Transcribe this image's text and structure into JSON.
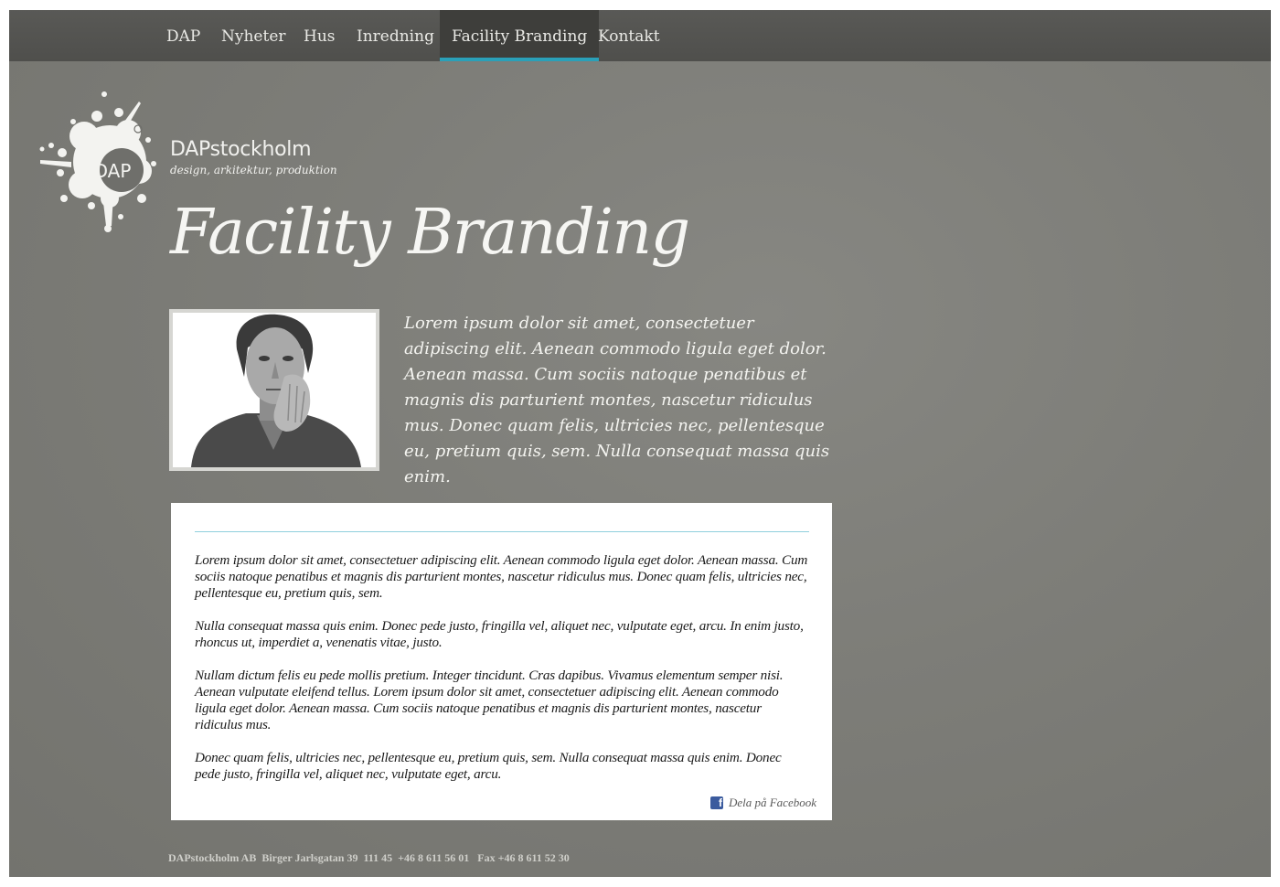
{
  "nav": {
    "items": [
      {
        "label": "DAP"
      },
      {
        "label": "Nyheter"
      },
      {
        "label": "Hus"
      },
      {
        "label": "Inredning"
      },
      {
        "label": "Facility Branding",
        "active": true
      },
      {
        "label": "Kontakt"
      }
    ]
  },
  "brand": {
    "logo_text": "DAP",
    "name": "DAPstockholm",
    "tagline": "design, arkitektur, produktion"
  },
  "page": {
    "title": "Facility Branding",
    "intro": "Lorem ipsum dolor sit amet, consectetuer adipiscing elit. Aenean commodo ligula eget dolor. Aenean massa. Cum sociis natoque penatibus et magnis dis parturient montes, nascetur ridiculus mus. Donec quam felis, ultricies nec, pellentesque eu, pretium quis, sem. Nulla consequat massa quis enim."
  },
  "article": {
    "paragraphs": [
      "Lorem ipsum dolor sit amet, consectetuer adipiscing elit. Aenean commodo ligula eget dolor. Aenean massa. Cum sociis natoque penatibus et magnis dis parturient montes, nascetur ridiculus mus. Donec quam felis, ultricies nec, pellentesque eu, pretium quis, sem.",
      "Nulla consequat massa quis enim. Donec pede justo, fringilla vel, aliquet nec, vulputate eget, arcu. In enim justo, rhoncus ut, imperdiet a, venenatis vitae, justo.",
      "Nullam dictum felis eu pede mollis pretium. Integer tincidunt. Cras dapibus. Vivamus elementum semper nisi. Aenean vulputate eleifend tellus. Lorem ipsum dolor sit amet, consectetuer adipiscing elit. Aenean commodo ligula eget dolor. Aenean massa. Cum sociis natoque penatibus et magnis dis parturient montes, nascetur ridiculus mus.",
      "Donec quam felis, ultricies nec, pellentesque eu, pretium quis, sem. Nulla consequat massa quis enim. Donec pede justo, fringilla vel, aliquet nec, vulputate eget, arcu."
    ],
    "share_label": "Dela på Facebook",
    "share_icon": "facebook-icon"
  },
  "footer": {
    "text": "DAPstockholm AB  Birger Jarlsgatan 39  111 45  +46 8 611 56 01   Fax +46 8 611 52 30"
  },
  "colors": {
    "background": "#7d7d78",
    "nav": "#52524f",
    "nav_active": "#3e3e3b",
    "accent": "#2aa0b8",
    "card": "#ffffff",
    "facebook": "#3b5b9e"
  }
}
